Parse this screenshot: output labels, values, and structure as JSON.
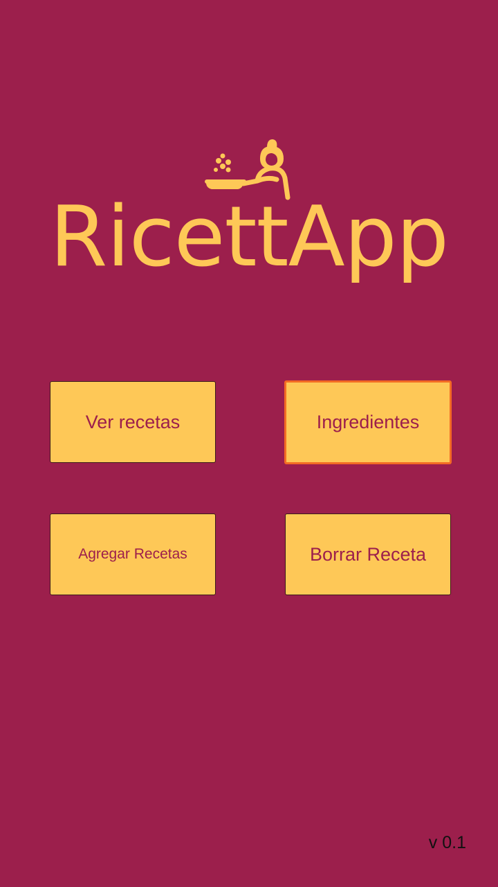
{
  "app": {
    "logo_text": "RicettApp",
    "version": "v 0.1"
  },
  "menu": {
    "view_recipes": "Ver recetas",
    "ingredients": "Ingredientes",
    "add_recipes": "Agregar Recetas",
    "delete_recipe": "Borrar Receta"
  },
  "colors": {
    "background": "#9c1f4c",
    "accent": "#fec857",
    "focus_border": "#f36b24"
  },
  "icons": {
    "logo_icon": "chef-cooking-pan-icon"
  }
}
